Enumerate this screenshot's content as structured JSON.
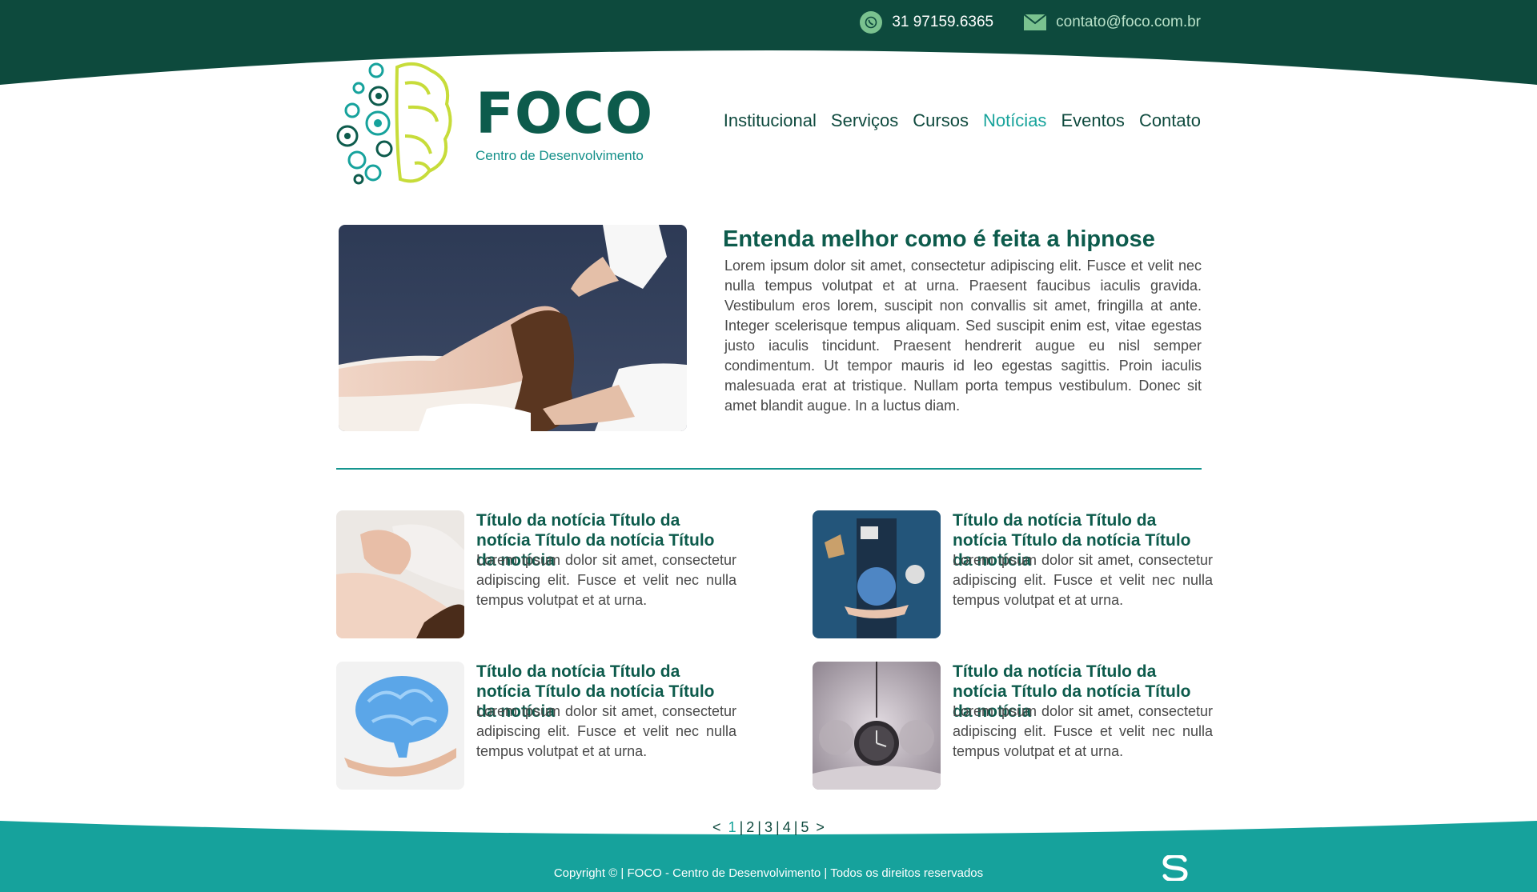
{
  "colors": {
    "top_band": "#0d4a3d",
    "bottom_band": "#16a29c",
    "accent": "#17a39b",
    "brand_dark": "#0d5b4c",
    "brand_lime": "#c7dc3a"
  },
  "header": {
    "phone": "31 97159.6365",
    "email": "contato@foco.com.br",
    "phone_icon": "whatsapp-icon",
    "email_icon": "envelope-icon"
  },
  "logo": {
    "title": "FOCO",
    "subtitle": "Centro de Desenvolvimento",
    "icon": "brain-gears-icon"
  },
  "nav": {
    "items": [
      {
        "label": "Institucional"
      },
      {
        "label": "Serviços"
      },
      {
        "label": "Cursos"
      },
      {
        "label": "Notícias",
        "active": true
      },
      {
        "label": "Eventos"
      },
      {
        "label": "Contato"
      }
    ]
  },
  "featured": {
    "title": "Entenda melhor como é feita a hipnose",
    "text": "Lorem ipsum dolor sit amet, consectetur adipiscing elit. Fusce et velit nec nulla tempus volutpat et at urna. Praesent faucibus iaculis gravida. Vestibulum eros lorem, suscipit non convallis sit amet, fringilla at ante. Integer scelerisque tempus aliquam. Sed suscipit enim est, vitae egestas justo iaculis tincidunt. Praesent hendrerit augue eu nisl semper condimentum. Ut tempor mauris id leo egestas sagittis. Proin iaculis malesuada erat at tristique. Nullam porta tempus vestibulum. Donec sit amet blandit augue. In a luctus diam."
  },
  "news": [
    {
      "title": "Título da notícia Título da notícia Título da notícia Título da notícia",
      "text": "Lorem ipsum dolor sit amet, consectetur adipiscing elit. Fusce et velit nec nulla tempus volutpat et at urna."
    },
    {
      "title": "Título da notícia Título da notícia Título da notícia Título da notícia",
      "text": "Lorem ipsum dolor sit amet, consectetur adipiscing elit. Fusce et velit nec nulla tempus volutpat et at urna."
    },
    {
      "title": "Título da notícia Título da notícia Título da notícia Título da notícia",
      "text": "Lorem ipsum dolor sit amet, consectetur adipiscing elit. Fusce et velit nec nulla tempus volutpat et at urna."
    },
    {
      "title": "Título da notícia Título da notícia Título da notícia Título da notícia",
      "text": "Lorem ipsum dolor sit amet, consectetur adipiscing elit. Fusce et velit nec nulla tempus volutpat et at urna."
    }
  ],
  "pagination": {
    "prev": "<",
    "next": ">",
    "separator": "|",
    "pages": [
      "1",
      "2",
      "3",
      "4",
      "5"
    ],
    "current": "1"
  },
  "footer": {
    "copyright": "Copyright © | FOCO - Centro de Desenvolvimento | Todos os direitos reservados",
    "mark_icon": "developer-s-logo-icon"
  }
}
